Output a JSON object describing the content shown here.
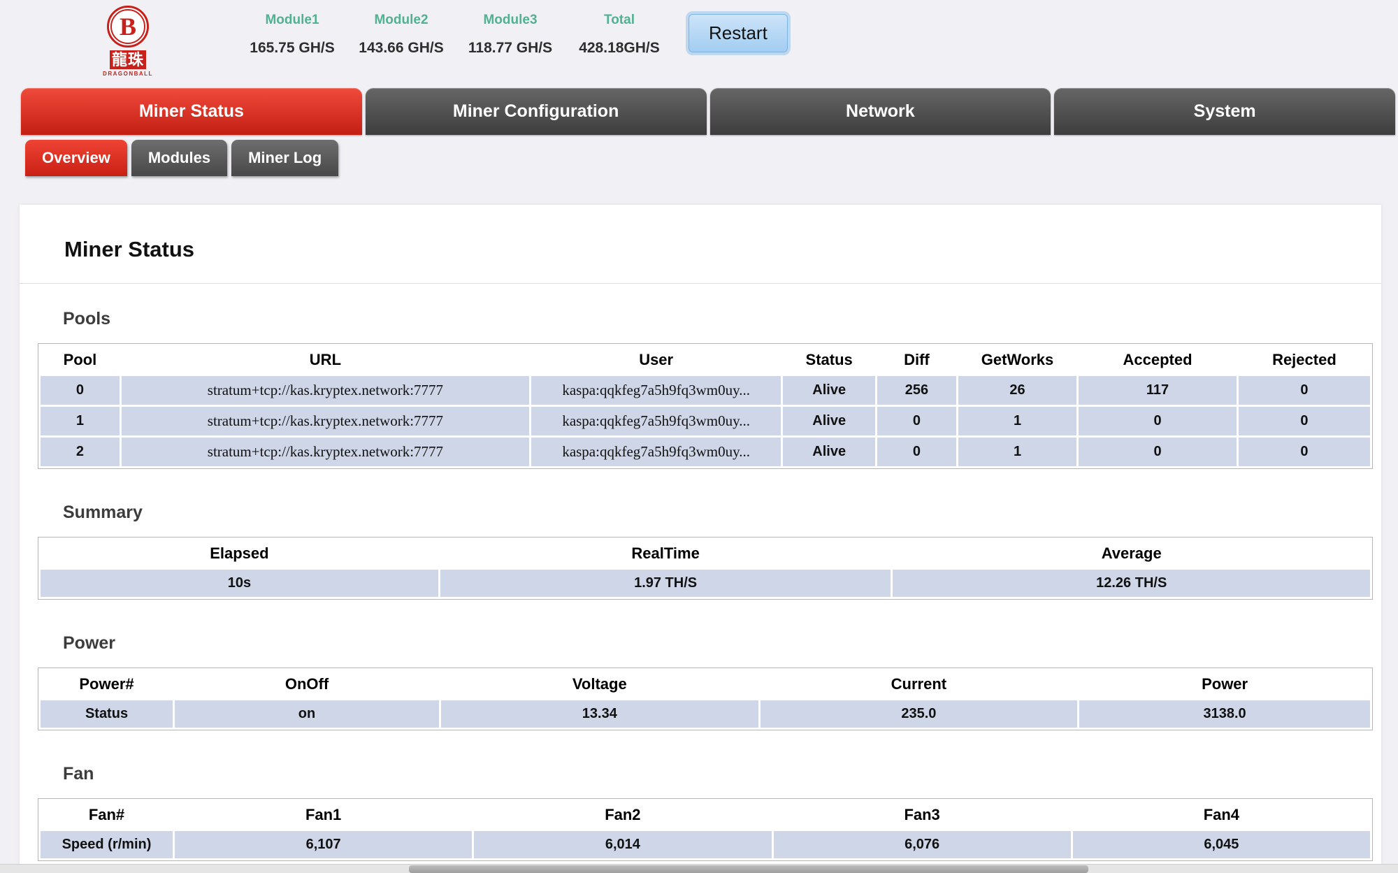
{
  "colors": {
    "accent_red": "#c8201a",
    "tab_active_red": "#d72a1c",
    "tab_gray": "#4a4a4a",
    "stat_label_green": "#53b091",
    "restart_blue": "#a2cdf1",
    "table_row_bg": "#cfd6e8"
  },
  "header": {
    "logo": {
      "letter": "B",
      "cn": "龍珠",
      "sub": "DRAGONBALL"
    },
    "stats": [
      {
        "label": "Module1",
        "value": "165.75 GH/S"
      },
      {
        "label": "Module2",
        "value": "143.66 GH/S"
      },
      {
        "label": "Module3",
        "value": "118.77 GH/S"
      },
      {
        "label": "Total",
        "value": "428.18GH/S"
      }
    ],
    "restart_label": "Restart"
  },
  "nav": {
    "tabs": [
      {
        "label": "Miner Status",
        "active": true
      },
      {
        "label": "Miner Configuration",
        "active": false
      },
      {
        "label": "Network",
        "active": false
      },
      {
        "label": "System",
        "active": false
      }
    ],
    "subtabs": [
      {
        "label": "Overview",
        "active": true
      },
      {
        "label": "Modules",
        "active": false
      },
      {
        "label": "Miner Log",
        "active": false
      }
    ]
  },
  "page": {
    "title": "Miner Status",
    "sections": {
      "pools": {
        "label": "Pools",
        "headers": [
          "Pool",
          "URL",
          "User",
          "Status",
          "Diff",
          "GetWorks",
          "Accepted",
          "Rejected"
        ],
        "rows": [
          [
            "0",
            "stratum+tcp://kas.kryptex.network:7777",
            "kaspa:qqkfeg7a5h9fq3wm0uy...",
            "Alive",
            "256",
            "26",
            "117",
            "0"
          ],
          [
            "1",
            "stratum+tcp://kas.kryptex.network:7777",
            "kaspa:qqkfeg7a5h9fq3wm0uy...",
            "Alive",
            "0",
            "1",
            "0",
            "0"
          ],
          [
            "2",
            "stratum+tcp://kas.kryptex.network:7777",
            "kaspa:qqkfeg7a5h9fq3wm0uy...",
            "Alive",
            "0",
            "1",
            "0",
            "0"
          ]
        ]
      },
      "summary": {
        "label": "Summary",
        "headers": [
          "Elapsed",
          "RealTime",
          "Average"
        ],
        "rows": [
          [
            "10s",
            "1.97 TH/S",
            "12.26 TH/S"
          ]
        ]
      },
      "power": {
        "label": "Power",
        "headers": [
          "Power#",
          "OnOff",
          "Voltage",
          "Current",
          "Power"
        ],
        "rows": [
          [
            "Status",
            "on",
            "13.34",
            "235.0",
            "3138.0"
          ]
        ]
      },
      "fan": {
        "label": "Fan",
        "headers": [
          "Fan#",
          "Fan1",
          "Fan2",
          "Fan3",
          "Fan4"
        ],
        "rows": [
          [
            "Speed (r/min)",
            "6,107",
            "6,014",
            "6,076",
            "6,045"
          ]
        ]
      }
    }
  }
}
